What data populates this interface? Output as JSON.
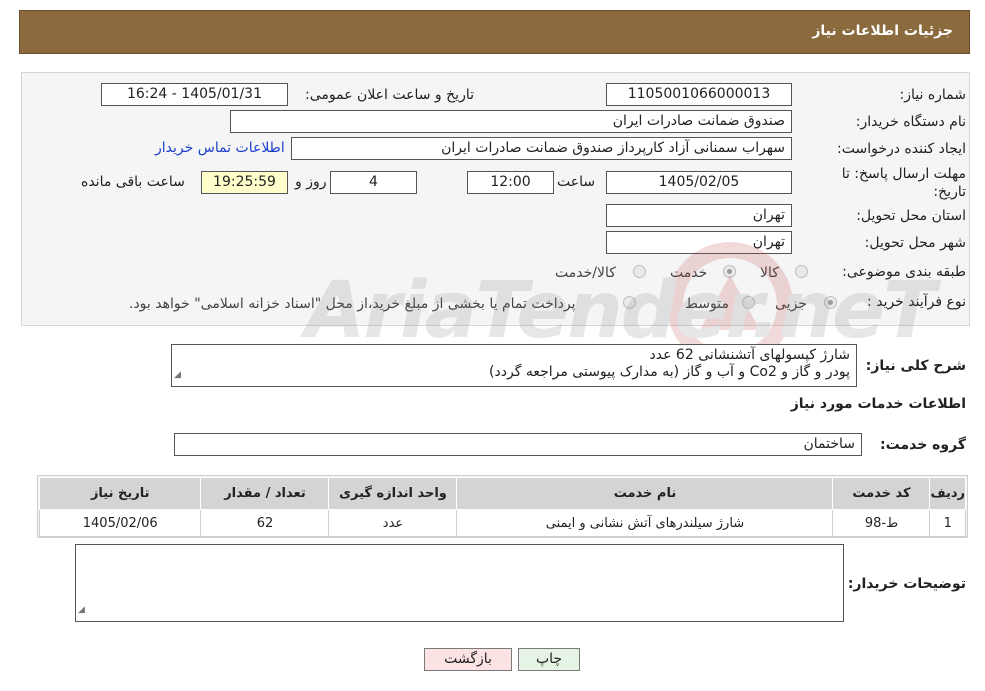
{
  "header": {
    "title": "جزئیات اطلاعات نیاز"
  },
  "form": {
    "need_number_label": "شماره نیاز:",
    "need_number": "1105001066000013",
    "announce_label": "تاریخ و ساعت اعلان عمومی:",
    "announce_value": "1405/01/31 - 16:24",
    "buyer_org_label": "نام دستگاه خریدار:",
    "buyer_org": "صندوق ضمانت صادرات ایران",
    "creator_label": "ایجاد کننده درخواست:",
    "creator": "سهراب سمنانی آزاد کارپرداز صندوق ضمانت صادرات ایران",
    "contact_link": "اطلاعات تماس خریدار",
    "deadline_label_1": "مهلت ارسال پاسخ: تا",
    "deadline_label_2": "تاریخ:",
    "deadline_date": "1405/02/05",
    "time_label": "ساعت",
    "deadline_time": "12:00",
    "days_value": "4",
    "days_label": "روز و",
    "remaining_time": "19:25:59",
    "remaining_label": "ساعت باقی مانده",
    "province_label": "استان محل تحویل:",
    "province": "تهران",
    "city_label": "شهر محل تحویل:",
    "city": "تهران",
    "category_label": "طبقه بندی موضوعی:",
    "category_options": [
      "کالا",
      "خدمت",
      "کالا/خدمت"
    ],
    "process_label": "نوع فرآیند خرید :",
    "process_options": [
      "جزیی",
      "متوسط"
    ],
    "process_note": "پرداخت تمام یا بخشی از مبلغ خرید،از محل \"اسناد خزانه اسلامی\" خواهد بود."
  },
  "description": {
    "label": "شرح کلی نیاز:",
    "line1": "شارژ کپسولهای آتشنشانی 62 عدد",
    "line2": "پودر و گاز و Co2 و آب و گاز (به مدارک پیوستی مراجعه گردد)"
  },
  "services": {
    "title": "اطلاعات خدمات مورد نیاز",
    "group_label": "گروه خدمت:",
    "group_value": "ساختمان",
    "columns": [
      "ردیف",
      "کد خدمت",
      "نام خدمت",
      "واحد اندازه گیری",
      "تعداد / مقدار",
      "تاریخ نیاز"
    ],
    "rows": [
      [
        "1",
        "ط-98",
        "شارژ سیلندرهای آتش نشانی و ایمنی",
        "عدد",
        "62",
        "1405/02/06"
      ]
    ]
  },
  "buyer_notes": {
    "label": "توضیحات خریدار:",
    "value": ""
  },
  "buttons": {
    "print": "چاپ",
    "back": "بازگشت"
  },
  "watermark": {
    "text": "AriaTender.neT"
  },
  "colors": {
    "header_bg": "#8b6a3e",
    "link": "#1a3fcc",
    "remaining_bg": "#ffffcc"
  }
}
